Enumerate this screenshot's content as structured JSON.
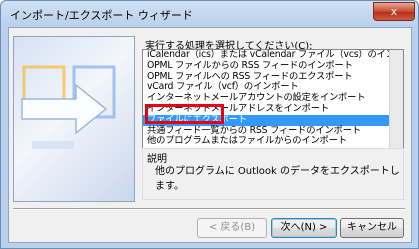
{
  "window": {
    "title": "インポート/エクスポート ウィザード",
    "close_glyph": "x"
  },
  "prompt": "実行する処理を選択してください(C):",
  "list": {
    "items": [
      "iCalendar（ics）または vCalendar ファイル（vcs）のインポート",
      "OPML ファイルからの RSS フィードのインポート",
      "OPML ファイルへの RSS フィードのエクスポート",
      "vCard ファイル（vcf）のインポート",
      "インターネットメールアカウントの設定をインポート",
      "インターネットメールアドレスをインポート",
      "ファイルにエクスポート",
      "共通フィード一覧からの RSS フィードのインポート",
      "他のプログラムまたはファイルからのインポート"
    ],
    "selected_index": 6
  },
  "description": {
    "label": "説明",
    "text": "他のプログラムに Outlook のデータをエクスポートします。"
  },
  "buttons": {
    "back": "< 戻る(B)",
    "next": "次へ(N) >",
    "cancel": "キャンセル"
  },
  "colors": {
    "selection": "#3399ff",
    "highlight_box": "#e60012"
  }
}
